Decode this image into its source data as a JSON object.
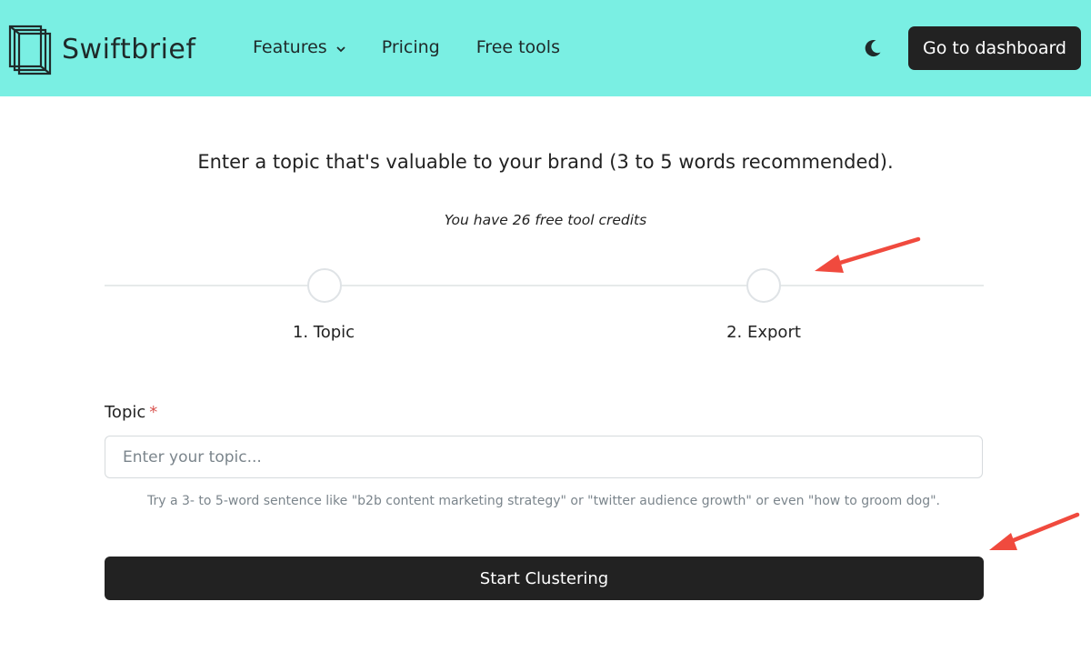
{
  "header": {
    "brand": "Swiftbrief",
    "background": "#7aefe3",
    "nav": [
      {
        "label": "Features",
        "icon": "chevron-down-icon"
      },
      {
        "label": "Pricing"
      },
      {
        "label": "Free tools"
      }
    ],
    "theme_toggle_icon": "moon-icon",
    "dashboard_button": "Go to dashboard"
  },
  "main": {
    "headline": "Enter a topic that's valuable to your brand (3 to 5 words recommended).",
    "credits": "You have 26 free tool credits",
    "steps": [
      {
        "label": "1. Topic"
      },
      {
        "label": "2. Export"
      }
    ],
    "form": {
      "topic_label": "Topic",
      "required_mark": "*",
      "topic_placeholder": "Enter your topic...",
      "topic_value": "",
      "hint": "Try a 3- to 5-word sentence like \"b2b content marketing strategy\" or \"twitter audience growth\" or even \"how to groom dog\".",
      "submit_label": "Start Clustering"
    }
  },
  "annotations": {
    "arrow_color": "#f04a3e"
  }
}
